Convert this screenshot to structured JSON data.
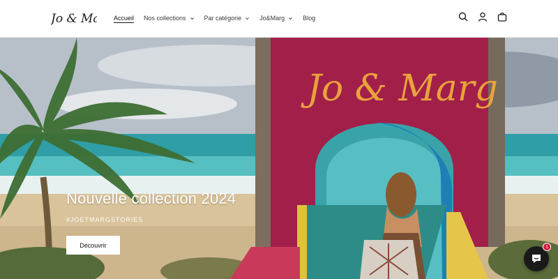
{
  "brand": {
    "logo_text": "Jo & Marg"
  },
  "nav": {
    "items": [
      {
        "label": "Accueil",
        "active": true,
        "dropdown": false
      },
      {
        "label": "Nos collections",
        "active": false,
        "dropdown": true
      },
      {
        "label": "Par catégorie",
        "active": false,
        "dropdown": true
      },
      {
        "label": "Jo&Marg",
        "active": false,
        "dropdown": true
      },
      {
        "label": "Blog",
        "active": false,
        "dropdown": false
      }
    ]
  },
  "header_icons": [
    "search-icon",
    "account-icon",
    "cart-icon"
  ],
  "hero": {
    "wall_text": "Jo & Marg",
    "title": "Nouvelle collection 2024",
    "subtitle": "#JOETMARGSTORIES",
    "button_label": "Découvrir"
  },
  "chat": {
    "badge_count": "1"
  },
  "colors": {
    "accent_wall": "#a21f4a",
    "wall_text": "#e8a33c",
    "badge": "#d0193b"
  }
}
